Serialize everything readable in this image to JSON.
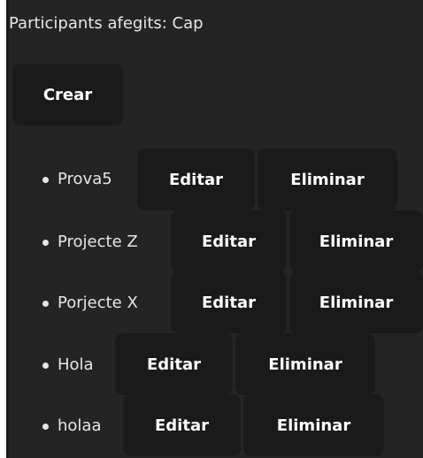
{
  "header": {
    "title": "Participants afegits: Cap"
  },
  "toolbar": {
    "create_label": "Crear"
  },
  "projects": [
    {
      "name": "Prova5",
      "edit_label": "Editar",
      "delete_label": "Eliminar"
    },
    {
      "name": "Projecte Z",
      "edit_label": "Editar",
      "delete_label": "Eliminar"
    },
    {
      "name": "Porjecte X",
      "edit_label": "Editar",
      "delete_label": "Eliminar"
    },
    {
      "name": "Hola",
      "edit_label": "Editar",
      "delete_label": "Eliminar"
    },
    {
      "name": "holaa",
      "edit_label": "Editar",
      "delete_label": "Eliminar"
    }
  ]
}
